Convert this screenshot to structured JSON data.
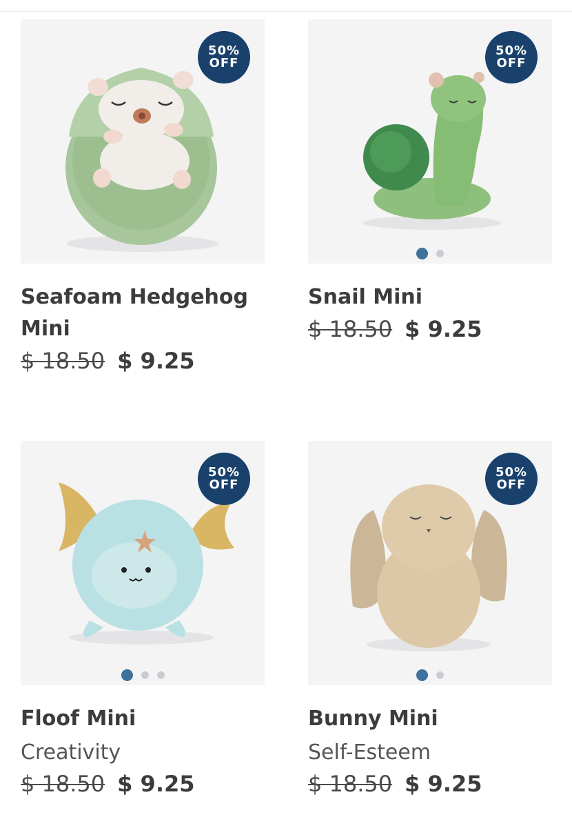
{
  "products": [
    {
      "name": "Seafoam Hedgehog Mini",
      "badge_line1": "50%",
      "badge_line2": "OFF",
      "old_price": "$ 18.50",
      "new_price": "$ 9.25",
      "image_icon": "green-hedgehog-plush",
      "colors": {
        "primary": "#9bbf8e"
      }
    },
    {
      "name": "Snail Mini",
      "badge_line1": "50%",
      "badge_line2": "OFF",
      "old_price": "$ 18.50",
      "new_price": "$ 9.25",
      "image_icon": "green-snail-plush",
      "carousel_dots": 2,
      "active_dot": 1
    },
    {
      "name": "Floof Mini",
      "subtitle": "Creativity",
      "badge_line1": "50%",
      "badge_line2": "OFF",
      "old_price": "$ 18.50",
      "new_price": "$ 9.25",
      "image_icon": "blue-floof-plush",
      "carousel_dots": 3,
      "active_dot": 1
    },
    {
      "name": "Bunny Mini",
      "subtitle": "Self-Esteem",
      "badge_line1": "50%",
      "badge_line2": "OFF",
      "old_price": "$ 18.50",
      "new_price": "$ 9.25",
      "image_icon": "tan-bunny-plush",
      "carousel_dots": 2,
      "active_dot": 1
    }
  ],
  "colors": {
    "badge": "#19416b",
    "dot_active": "#3c729c",
    "dot_inactive": "#c9cdd1",
    "text": "#3c3c3c"
  }
}
